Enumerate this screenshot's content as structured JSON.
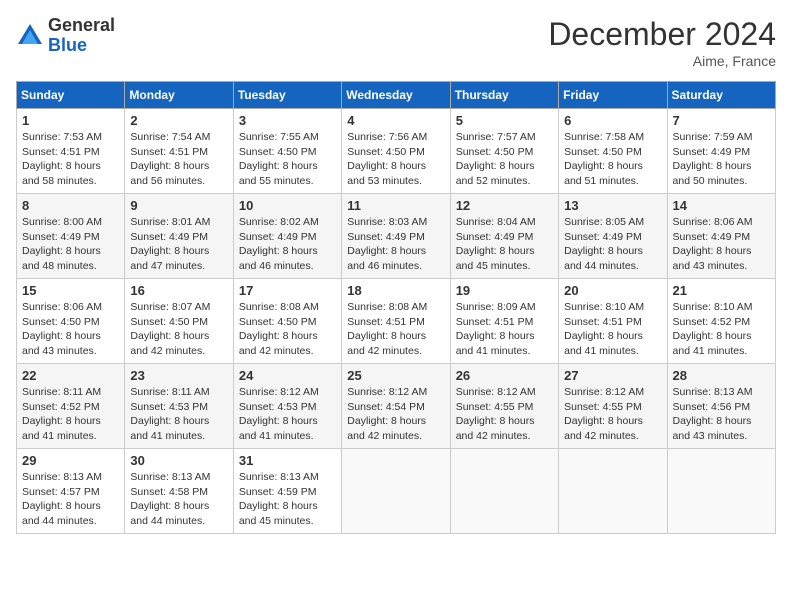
{
  "header": {
    "logo_general": "General",
    "logo_blue": "Blue",
    "title": "December 2024",
    "location": "Aime, France"
  },
  "weekdays": [
    "Sunday",
    "Monday",
    "Tuesday",
    "Wednesday",
    "Thursday",
    "Friday",
    "Saturday"
  ],
  "weeks": [
    [
      {
        "day": "1",
        "lines": [
          "Sunrise: 7:53 AM",
          "Sunset: 4:51 PM",
          "Daylight: 8 hours",
          "and 58 minutes."
        ]
      },
      {
        "day": "2",
        "lines": [
          "Sunrise: 7:54 AM",
          "Sunset: 4:51 PM",
          "Daylight: 8 hours",
          "and 56 minutes."
        ]
      },
      {
        "day": "3",
        "lines": [
          "Sunrise: 7:55 AM",
          "Sunset: 4:50 PM",
          "Daylight: 8 hours",
          "and 55 minutes."
        ]
      },
      {
        "day": "4",
        "lines": [
          "Sunrise: 7:56 AM",
          "Sunset: 4:50 PM",
          "Daylight: 8 hours",
          "and 53 minutes."
        ]
      },
      {
        "day": "5",
        "lines": [
          "Sunrise: 7:57 AM",
          "Sunset: 4:50 PM",
          "Daylight: 8 hours",
          "and 52 minutes."
        ]
      },
      {
        "day": "6",
        "lines": [
          "Sunrise: 7:58 AM",
          "Sunset: 4:50 PM",
          "Daylight: 8 hours",
          "and 51 minutes."
        ]
      },
      {
        "day": "7",
        "lines": [
          "Sunrise: 7:59 AM",
          "Sunset: 4:49 PM",
          "Daylight: 8 hours",
          "and 50 minutes."
        ]
      }
    ],
    [
      {
        "day": "8",
        "lines": [
          "Sunrise: 8:00 AM",
          "Sunset: 4:49 PM",
          "Daylight: 8 hours",
          "and 48 minutes."
        ]
      },
      {
        "day": "9",
        "lines": [
          "Sunrise: 8:01 AM",
          "Sunset: 4:49 PM",
          "Daylight: 8 hours",
          "and 47 minutes."
        ]
      },
      {
        "day": "10",
        "lines": [
          "Sunrise: 8:02 AM",
          "Sunset: 4:49 PM",
          "Daylight: 8 hours",
          "and 46 minutes."
        ]
      },
      {
        "day": "11",
        "lines": [
          "Sunrise: 8:03 AM",
          "Sunset: 4:49 PM",
          "Daylight: 8 hours",
          "and 46 minutes."
        ]
      },
      {
        "day": "12",
        "lines": [
          "Sunrise: 8:04 AM",
          "Sunset: 4:49 PM",
          "Daylight: 8 hours",
          "and 45 minutes."
        ]
      },
      {
        "day": "13",
        "lines": [
          "Sunrise: 8:05 AM",
          "Sunset: 4:49 PM",
          "Daylight: 8 hours",
          "and 44 minutes."
        ]
      },
      {
        "day": "14",
        "lines": [
          "Sunrise: 8:06 AM",
          "Sunset: 4:49 PM",
          "Daylight: 8 hours",
          "and 43 minutes."
        ]
      }
    ],
    [
      {
        "day": "15",
        "lines": [
          "Sunrise: 8:06 AM",
          "Sunset: 4:50 PM",
          "Daylight: 8 hours",
          "and 43 minutes."
        ]
      },
      {
        "day": "16",
        "lines": [
          "Sunrise: 8:07 AM",
          "Sunset: 4:50 PM",
          "Daylight: 8 hours",
          "and 42 minutes."
        ]
      },
      {
        "day": "17",
        "lines": [
          "Sunrise: 8:08 AM",
          "Sunset: 4:50 PM",
          "Daylight: 8 hours",
          "and 42 minutes."
        ]
      },
      {
        "day": "18",
        "lines": [
          "Sunrise: 8:08 AM",
          "Sunset: 4:51 PM",
          "Daylight: 8 hours",
          "and 42 minutes."
        ]
      },
      {
        "day": "19",
        "lines": [
          "Sunrise: 8:09 AM",
          "Sunset: 4:51 PM",
          "Daylight: 8 hours",
          "and 41 minutes."
        ]
      },
      {
        "day": "20",
        "lines": [
          "Sunrise: 8:10 AM",
          "Sunset: 4:51 PM",
          "Daylight: 8 hours",
          "and 41 minutes."
        ]
      },
      {
        "day": "21",
        "lines": [
          "Sunrise: 8:10 AM",
          "Sunset: 4:52 PM",
          "Daylight: 8 hours",
          "and 41 minutes."
        ]
      }
    ],
    [
      {
        "day": "22",
        "lines": [
          "Sunrise: 8:11 AM",
          "Sunset: 4:52 PM",
          "Daylight: 8 hours",
          "and 41 minutes."
        ]
      },
      {
        "day": "23",
        "lines": [
          "Sunrise: 8:11 AM",
          "Sunset: 4:53 PM",
          "Daylight: 8 hours",
          "and 41 minutes."
        ]
      },
      {
        "day": "24",
        "lines": [
          "Sunrise: 8:12 AM",
          "Sunset: 4:53 PM",
          "Daylight: 8 hours",
          "and 41 minutes."
        ]
      },
      {
        "day": "25",
        "lines": [
          "Sunrise: 8:12 AM",
          "Sunset: 4:54 PM",
          "Daylight: 8 hours",
          "and 42 minutes."
        ]
      },
      {
        "day": "26",
        "lines": [
          "Sunrise: 8:12 AM",
          "Sunset: 4:55 PM",
          "Daylight: 8 hours",
          "and 42 minutes."
        ]
      },
      {
        "day": "27",
        "lines": [
          "Sunrise: 8:12 AM",
          "Sunset: 4:55 PM",
          "Daylight: 8 hours",
          "and 42 minutes."
        ]
      },
      {
        "day": "28",
        "lines": [
          "Sunrise: 8:13 AM",
          "Sunset: 4:56 PM",
          "Daylight: 8 hours",
          "and 43 minutes."
        ]
      }
    ],
    [
      {
        "day": "29",
        "lines": [
          "Sunrise: 8:13 AM",
          "Sunset: 4:57 PM",
          "Daylight: 8 hours",
          "and 44 minutes."
        ]
      },
      {
        "day": "30",
        "lines": [
          "Sunrise: 8:13 AM",
          "Sunset: 4:58 PM",
          "Daylight: 8 hours",
          "and 44 minutes."
        ]
      },
      {
        "day": "31",
        "lines": [
          "Sunrise: 8:13 AM",
          "Sunset: 4:59 PM",
          "Daylight: 8 hours",
          "and 45 minutes."
        ]
      },
      null,
      null,
      null,
      null
    ]
  ]
}
